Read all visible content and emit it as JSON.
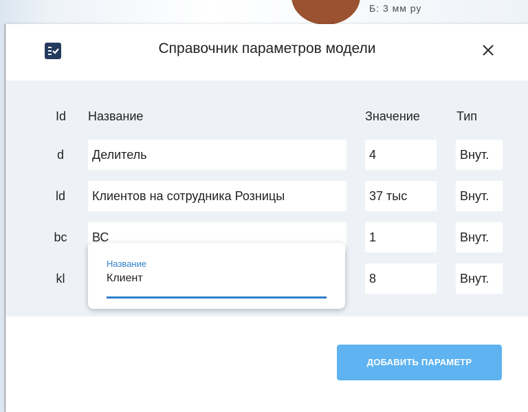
{
  "background": {
    "peek_text": "Б: 3 мм ру"
  },
  "dialog": {
    "icon": "checklist-icon",
    "title": "Справочник параметров модели",
    "close_icon": "close-icon"
  },
  "table": {
    "headers": {
      "id": "Id",
      "name": "Название",
      "value": "Значение",
      "type": "Тип"
    },
    "rows": [
      {
        "id": "d",
        "name": "Делитель",
        "value": "4",
        "type": "Внут."
      },
      {
        "id": "ld",
        "name": "Клиентов на сотрудника Розницы",
        "value": "37 тыс",
        "type": "Внут."
      },
      {
        "id": "bc",
        "name": "ВС",
        "value": "1",
        "type": "Внут."
      },
      {
        "id": "kl",
        "name": "",
        "value": "8",
        "type": "Внут."
      }
    ]
  },
  "edit_popup": {
    "label": "Название",
    "value": "Клиент"
  },
  "add_button": {
    "label": "ДОБАВИТЬ ПАРАМЕТР"
  },
  "colors": {
    "accent": "#2f7ec9",
    "button": "#5eb3f0",
    "icon_bg": "#243b5e",
    "content_bg": "#eef2f7"
  }
}
